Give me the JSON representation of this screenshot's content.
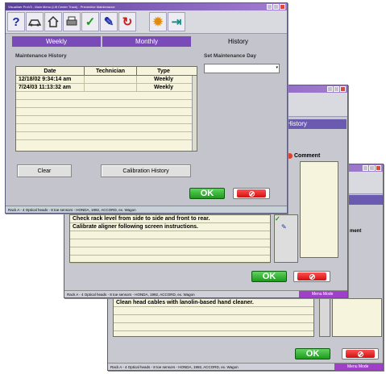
{
  "window3": {
    "title": "",
    "tab_partial": "ry",
    "col_partial": "ment",
    "rows": [
      "Clean head cables with lanolin-based hand cleaner.",
      "",
      "",
      ""
    ],
    "ok": "OK",
    "status": "Rack A - 4 Optical heads - 8 toe sensors - HONDA, 1992, ACCORD, ex. Wagon",
    "menu_mode": "Menu Mode"
  },
  "window2": {
    "title": "",
    "tab_partial": "History",
    "comment_label": "Comment",
    "rows": [
      "Check rack level from side to side and front to rear.",
      "Calibrate aligner following screen instructions.",
      "",
      "",
      "",
      ""
    ],
    "ok": "OK",
    "status": "Rack A - 4 Optical heads - 8 toe sensors - HONDA, 1992, ACCORD, ex. Wagon",
    "menu_mode": "Menu Mode"
  },
  "window1": {
    "title": "Visualiner ProV3 - Main Menu (Lift Center Track) - Preventive Maintenance",
    "tabs": {
      "weekly": "Weekly",
      "monthly": "Monthly",
      "history": "History"
    },
    "maintenance_history_label": "Maintenance History",
    "set_day_label": "Set Maintenance Day",
    "set_day_value": "",
    "table": {
      "headers": [
        "Date",
        "Technician",
        "Type"
      ],
      "rows": [
        [
          "12/18/02 9:34:14 am",
          "",
          "Weekly"
        ],
        [
          "7/24/03 11:13:32 am",
          "",
          "Weekly"
        ]
      ]
    },
    "clear_label": "Clear",
    "calibration_history_label": "Calibration History",
    "ok": "OK",
    "status": "Rack A - 4 Optical heads - 8 toe sensors - HONDA, 1992, ACCORD, ex. Wagon",
    "menu_mode": "Menu Mode"
  }
}
